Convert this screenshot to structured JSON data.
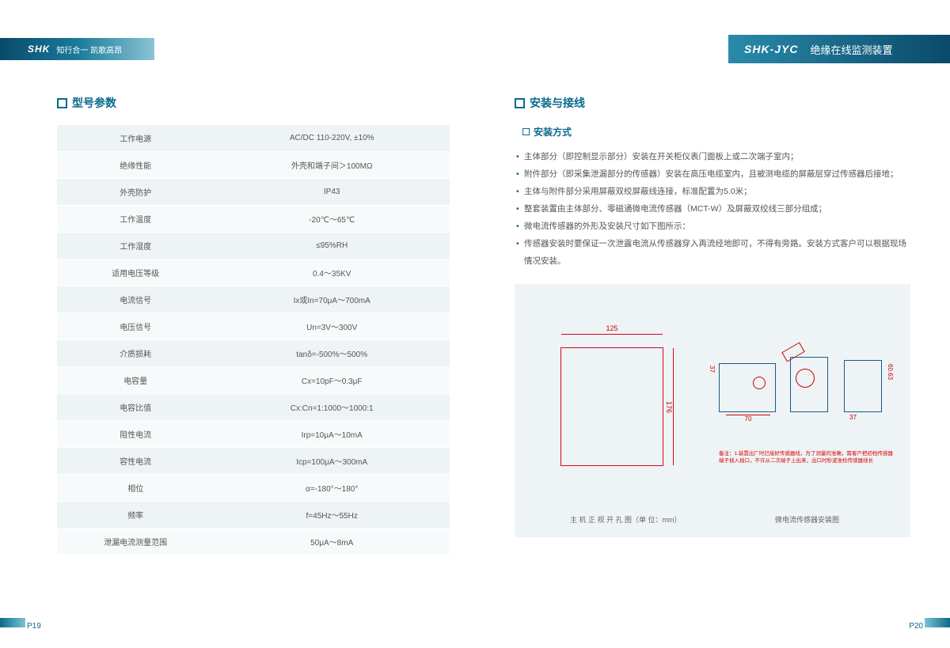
{
  "header": {
    "brand": "SHK",
    "tagline": "知行合一 凯歌高昂",
    "product": "SHK-JYC",
    "product_title": "绝缘在线监测装置"
  },
  "left": {
    "section_title": "型号参数",
    "specs": [
      {
        "k": "工作电源",
        "v": "AC/DC 110-220V, ±10%"
      },
      {
        "k": "绝缘性能",
        "v": "外壳和端子间＞100MΩ"
      },
      {
        "k": "外壳防护",
        "v": "IP43"
      },
      {
        "k": "工作温度",
        "v": "-20℃～65℃"
      },
      {
        "k": "工作湿度",
        "v": "≤95%RH"
      },
      {
        "k": "适用电压等级",
        "v": "0.4～35KV"
      },
      {
        "k": "电流信号",
        "v": "Ix或In=70μA～700mA"
      },
      {
        "k": "电压信号",
        "v": "Un=3V～300V"
      },
      {
        "k": "介质损耗",
        "v": "tanδ=-500%～500%"
      },
      {
        "k": "电容量",
        "v": "Cx=10pF～0.3μF"
      },
      {
        "k": "电容比值",
        "v": "Cx:Cn=1:1000～1000:1"
      },
      {
        "k": "阻性电流",
        "v": "Irp=10μA～10mA"
      },
      {
        "k": "容性电流",
        "v": "Icp=100μA～300mA"
      },
      {
        "k": "相位",
        "v": "α=-180°～180°"
      },
      {
        "k": "频率",
        "v": "f=45Hz～55Hz"
      },
      {
        "k": "泄漏电流测量范围",
        "v": "50μA～8mA"
      }
    ],
    "page_no": "P19"
  },
  "right": {
    "section_title": "安装与接线",
    "sub_title": "安装方式",
    "bullets": [
      "主体部分（即控制显示部分）安装在开关柜仪表门面板上或二次端子室内；",
      "附件部分（即采集泄漏部分的传感器）安装在高压电缆室内，且被测电缆的屏蔽层穿过传感器后接地；",
      "主体与附件部分采用屏蔽双绞屏蔽线连接，标准配置为5.0米；",
      "整套装置由主体部分、零磁通微电流传感器（MCT-W）及屏蔽双绞线三部分组成；",
      "微电流传感器的外形及安装尺寸如下图所示：",
      "传感器安装时要保证一次泄露电流从传感器穿入再流经地即可，不得有旁路。安装方式客户可以根据现场情况安装。"
    ],
    "diagram": {
      "host_w": "125",
      "host_h": "176",
      "sensor_w": "70",
      "sensor_h1": "37",
      "sensor_h2": "60.63",
      "sensor_b": "37",
      "note": "备注：1.装置出厂时已接好传感器线，为了测量的准确，需客户把初档传感器端子插入插口，不许从二次端子上出来，出口时秒波准检传感器线长",
      "caption_left": "主 机 正 视 开 孔 图（单 位：mm）",
      "caption_right": "微电流传感器安装图"
    },
    "page_no": "P20"
  }
}
